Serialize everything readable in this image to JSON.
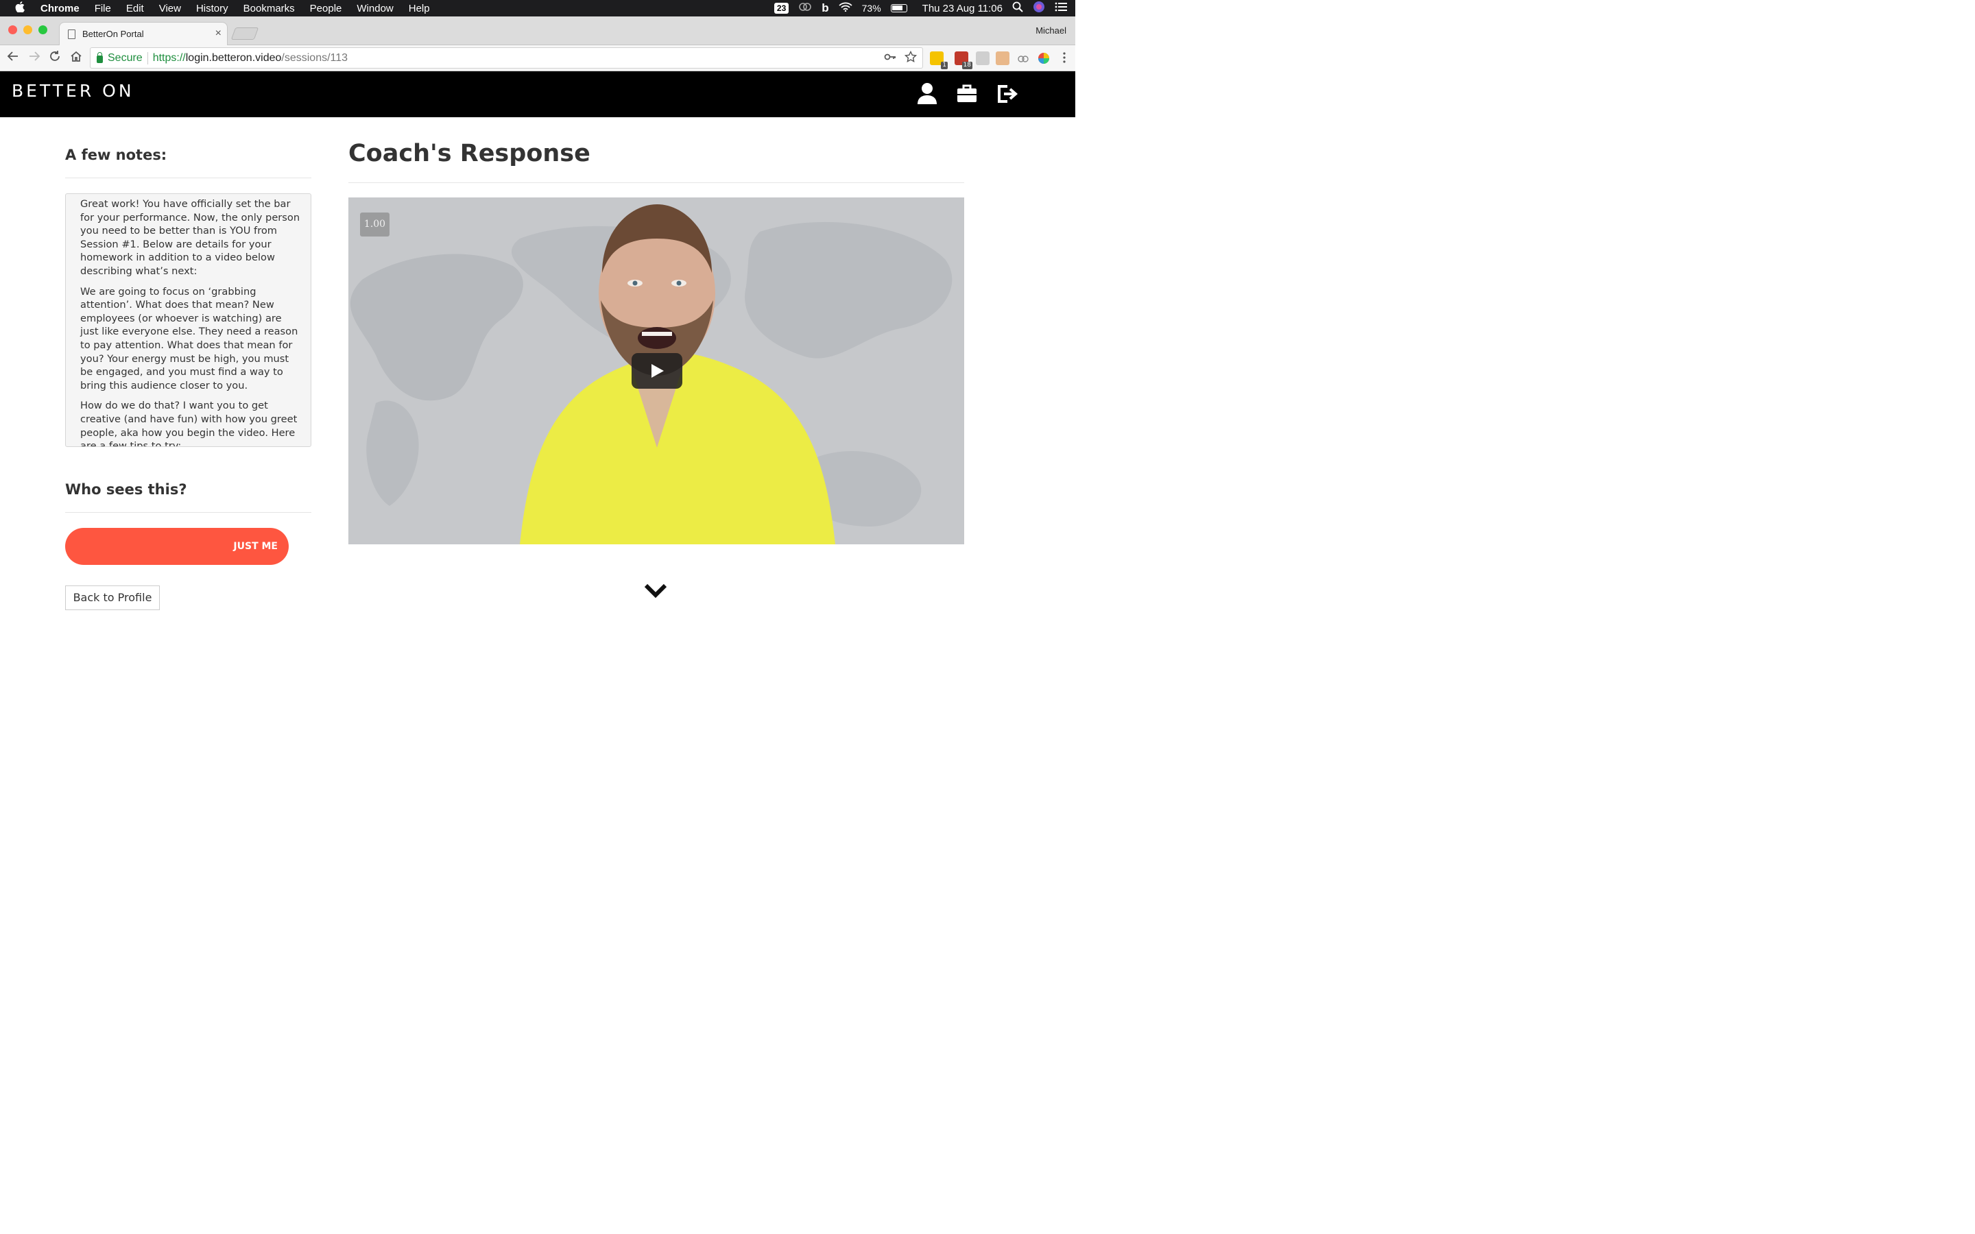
{
  "menubar": {
    "app": "Chrome",
    "items": [
      "File",
      "Edit",
      "View",
      "History",
      "Bookmarks",
      "People",
      "Window",
      "Help"
    ],
    "calendar_badge": "23",
    "battery": "73%",
    "datetime": "Thu 23 Aug  11:06"
  },
  "browser": {
    "tab_title": "BetterOn Portal",
    "profile": "Michael",
    "secure_label": "Secure",
    "url_scheme": "https://",
    "url_host": "login.betteron.video",
    "url_path": "/sessions/113",
    "ext_badge_1": "1",
    "ext_badge_2": "18"
  },
  "app": {
    "brand": "BETTER ON"
  },
  "notes": {
    "heading": "A few notes:",
    "paragraphs": [
      "Great work! You have officially set the bar for your performance. Now, the only person you need to be better than is YOU from Session #1. Below are details for your homework in addition to a video below describing what’s next:",
      "We are going to focus on ‘grabbing attention’. What does that mean? New employees (or whoever is watching) are just like everyone else. They need a reason to pay attention. What does that mean for you? Your energy must be high, you must be engaged, and you must find a way to bring this audience closer to you.",
      "How do we do that? I want you to get creative (and have fun) with how you greet people, aka how you begin the video. Here are a few tips to try:"
    ]
  },
  "visibility": {
    "heading": "Who sees this?",
    "button": "JUST ME"
  },
  "back_button": "Back to Profile",
  "response": {
    "heading": "Coach's Response",
    "speed": "1.00"
  }
}
